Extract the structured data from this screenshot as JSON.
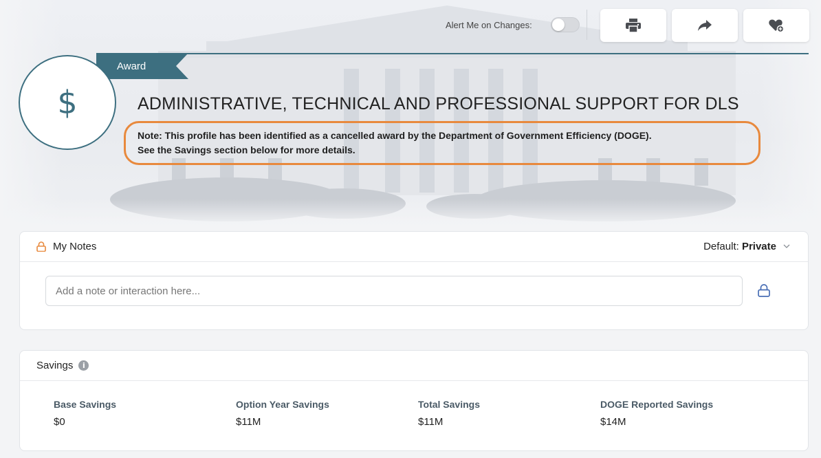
{
  "toolbar": {
    "alert_label": "Alert Me on Changes:",
    "alert_enabled": false,
    "buttons": [
      {
        "name": "print-button",
        "icon": "print-icon"
      },
      {
        "name": "share-button",
        "icon": "share-icon"
      },
      {
        "name": "favorite-button",
        "icon": "heart-add-icon"
      }
    ]
  },
  "profile": {
    "type_tag": "Award",
    "type_icon": "dollar-icon",
    "title": "ADMINISTRATIVE, TECHNICAL AND PROFESSIONAL SUPPORT FOR DLS",
    "note_line1": "Note: This profile has been identified as a cancelled award by the Department of Government Efficiency (DOGE).",
    "note_line2": "See the Savings section below for more details."
  },
  "notes": {
    "header": "My Notes",
    "default_label": "Default:",
    "default_value": "Private",
    "input_placeholder": "Add a note or interaction here...",
    "input_value": ""
  },
  "savings": {
    "header": "Savings",
    "metrics": [
      {
        "label": "Base Savings",
        "value": "$0"
      },
      {
        "label": "Option Year Savings",
        "value": "$11M"
      },
      {
        "label": "Total Savings",
        "value": "$11M"
      },
      {
        "label": "DOGE Reported Savings",
        "value": "$14M"
      }
    ]
  },
  "colors": {
    "accent_teal": "#3d6f80",
    "highlight_orange": "#e8893d",
    "lock_blue": "#4a6fb5",
    "lock_orange": "#e8893d"
  }
}
